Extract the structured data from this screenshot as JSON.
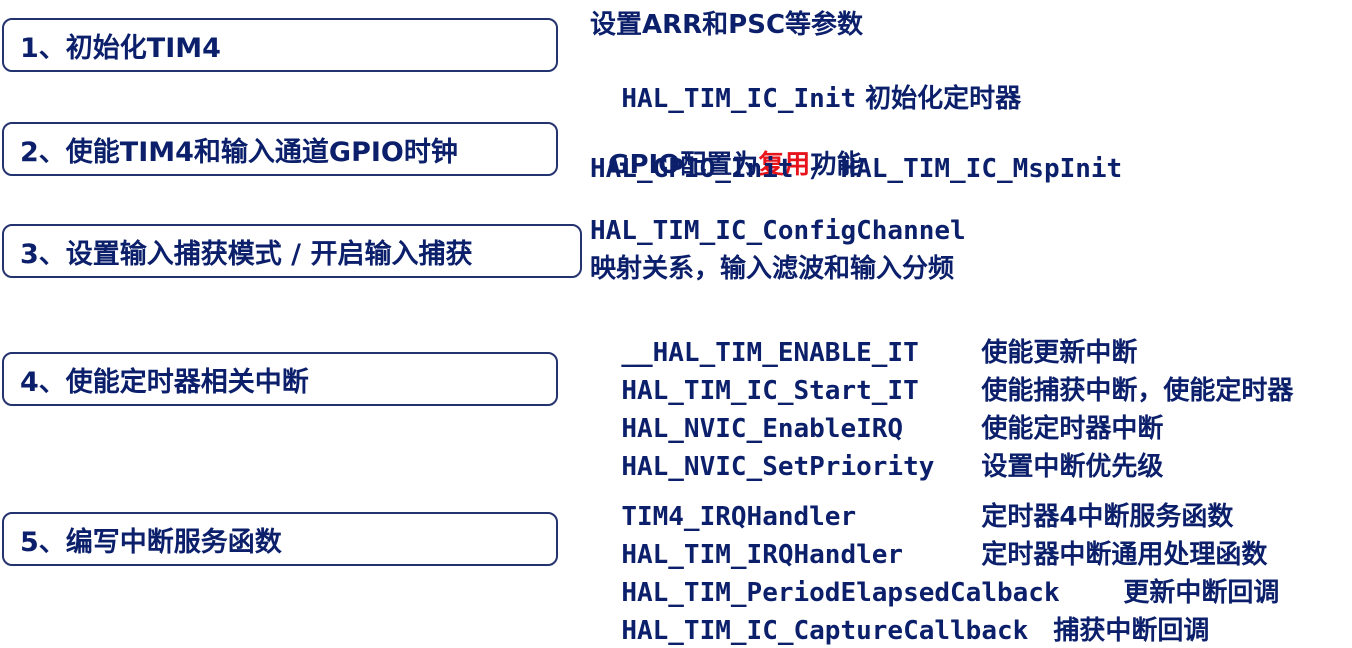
{
  "steps": [
    {
      "label": "1、初始化TIM4"
    },
    {
      "label": "2、使能TIM4和输入通道GPIO时钟"
    },
    {
      "label": "3、设置输入捕获模式 / 开启输入捕获"
    },
    {
      "label": "4、使能定时器相关中断"
    },
    {
      "label": "5、编写中断服务函数"
    }
  ],
  "group1": {
    "line1": "设置ARR和PSC等参数",
    "line2_fn": "HAL_TIM_IC_Init",
    "line2_desc": " 初始化定时器"
  },
  "group2": {
    "line1_pre": "GPIO配置为",
    "line1_highlight": "复用",
    "line1_post": "功能",
    "line2": "HAL_GPIO_Init / HAL_TIM_IC_MspInit"
  },
  "group3": {
    "line1": "HAL_TIM_IC_ConfigChannel",
    "line2": "映射关系，输入滤波和输入分频"
  },
  "group4": [
    {
      "fn": "__HAL_TIM_ENABLE_IT",
      "desc": "使能更新中断"
    },
    {
      "fn": "HAL_TIM_IC_Start_IT",
      "desc": "使能捕获中断，使能定时器"
    },
    {
      "fn": "HAL_NVIC_EnableIRQ",
      "desc": "使能定时器中断"
    },
    {
      "fn": "HAL_NVIC_SetPriority",
      "desc": "设置中断优先级"
    }
  ],
  "group5": [
    {
      "fn": "TIM4_IRQHandler",
      "desc": "定时器4中断服务函数"
    },
    {
      "fn": "HAL_TIM_IRQHandler",
      "desc": "定时器中断通用处理函数"
    },
    {
      "fn": "HAL_TIM_PeriodElapsedCalback",
      "desc": "更新中断回调"
    },
    {
      "fn": "HAL_TIM_IC_CaptureCallback",
      "desc": "捕获中断回调"
    }
  ],
  "colors": {
    "text": "#0b1f6b",
    "border": "#23336f",
    "highlight": "#e8141b"
  }
}
